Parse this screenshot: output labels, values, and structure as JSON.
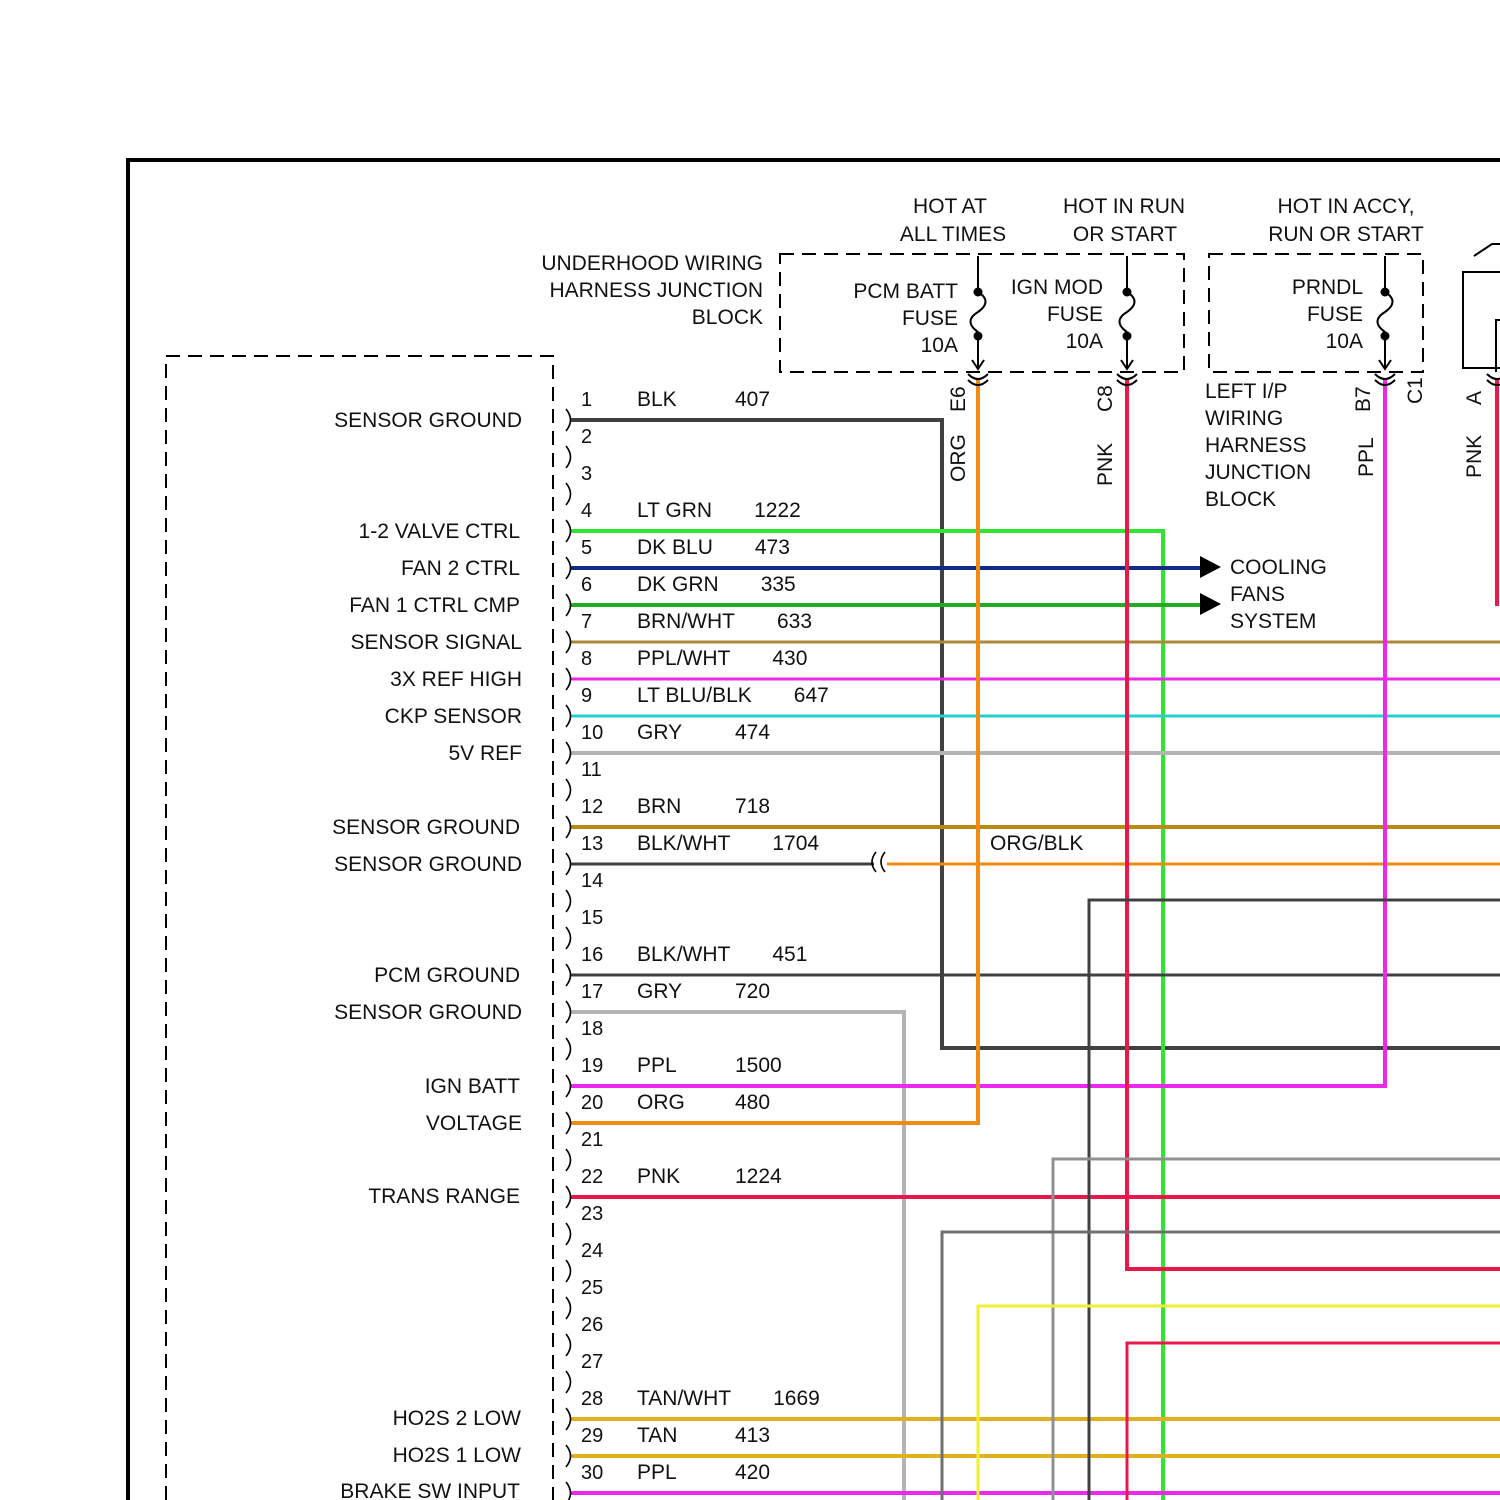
{
  "power_sources": [
    {
      "id": "hot-at-all-times",
      "lines": [
        "HOT AT",
        "ALL TIMES"
      ]
    },
    {
      "id": "hot-in-run-or-start",
      "lines": [
        "HOT IN RUN",
        "OR START"
      ]
    },
    {
      "id": "hot-in-accy-run-or-start",
      "lines": [
        "HOT IN ACCY,",
        "RUN OR START"
      ]
    }
  ],
  "junction_blocks": {
    "underhood": {
      "lines": [
        "UNDERHOOD WIRING",
        "HARNESS JUNCTION",
        "BLOCK"
      ]
    },
    "left_ip": {
      "lines": [
        "LEFT I/P",
        "WIRING",
        "HARNESS",
        "JUNCTION",
        "BLOCK"
      ]
    }
  },
  "fuses": [
    {
      "id": "pcm-batt",
      "lines": [
        "PCM BATT",
        "FUSE",
        "10A"
      ]
    },
    {
      "id": "ign-mod",
      "lines": [
        "IGN MOD",
        "FUSE",
        "10A"
      ]
    },
    {
      "id": "prndl",
      "lines": [
        "PRNDL",
        "FUSE",
        "10A"
      ]
    }
  ],
  "connector_terminals": [
    "E6",
    "C8",
    "B7",
    "C1",
    "A"
  ],
  "vertical_wire_labels": [
    "ORG",
    "PNK",
    "PPL",
    "PNK"
  ],
  "cooling_fans": {
    "lines": [
      "COOLING",
      "FANS",
      "SYSTEM"
    ]
  },
  "splice_label": "ORG/BLK",
  "pcm_functions": [
    {
      "pin": 1,
      "label": "SENSOR GROUND"
    },
    {
      "pin": 4,
      "label": "1-2 VALVE CTRL"
    },
    {
      "pin": 5,
      "label": "FAN 2 CTRL"
    },
    {
      "pin": 6,
      "label": "FAN 1 CTRL CMP"
    },
    {
      "pin": 7,
      "label": "SENSOR SIGNAL"
    },
    {
      "pin": 8,
      "label": "3X REF HIGH"
    },
    {
      "pin": 9,
      "label": "CKP SENSOR"
    },
    {
      "pin": 10,
      "label": "5V REF"
    },
    {
      "pin": 12,
      "label": "SENSOR GROUND"
    },
    {
      "pin": 13,
      "label": "SENSOR GROUND"
    },
    {
      "pin": 16,
      "label": "PCM GROUND"
    },
    {
      "pin": 17,
      "label": "SENSOR GROUND"
    },
    {
      "pin": 19,
      "label": "IGN BATT"
    },
    {
      "pin": 20,
      "label": "VOLTAGE"
    },
    {
      "pin": 22,
      "label": "TRANS RANGE"
    },
    {
      "pin": 28,
      "label": "HO2S 2 LOW"
    },
    {
      "pin": 29,
      "label": "HO2S 1 LOW"
    },
    {
      "pin": 30,
      "label": "BRAKE SW INPUT"
    }
  ],
  "pins": [
    {
      "n": "1",
      "color": "BLK",
      "circuit": "407"
    },
    {
      "n": "2",
      "color": "",
      "circuit": ""
    },
    {
      "n": "3",
      "color": "",
      "circuit": ""
    },
    {
      "n": "4",
      "color": "LT GRN",
      "circuit": "1222"
    },
    {
      "n": "5",
      "color": "DK BLU",
      "circuit": "473"
    },
    {
      "n": "6",
      "color": "DK GRN",
      "circuit": "335"
    },
    {
      "n": "7",
      "color": "BRN/WHT",
      "circuit": "633"
    },
    {
      "n": "8",
      "color": "PPL/WHT",
      "circuit": "430"
    },
    {
      "n": "9",
      "color": "LT BLU/BLK",
      "circuit": "647"
    },
    {
      "n": "10",
      "color": "GRY",
      "circuit": "474"
    },
    {
      "n": "11",
      "color": "",
      "circuit": ""
    },
    {
      "n": "12",
      "color": "BRN",
      "circuit": "718"
    },
    {
      "n": "13",
      "color": "BLK/WHT",
      "circuit": "1704"
    },
    {
      "n": "14",
      "color": "",
      "circuit": ""
    },
    {
      "n": "15",
      "color": "",
      "circuit": ""
    },
    {
      "n": "16",
      "color": "BLK/WHT",
      "circuit": "451"
    },
    {
      "n": "17",
      "color": "GRY",
      "circuit": "720"
    },
    {
      "n": "18",
      "color": "",
      "circuit": ""
    },
    {
      "n": "19",
      "color": "PPL",
      "circuit": "1500"
    },
    {
      "n": "20",
      "color": "ORG",
      "circuit": "480"
    },
    {
      "n": "21",
      "color": "",
      "circuit": ""
    },
    {
      "n": "22",
      "color": "PNK",
      "circuit": "1224"
    },
    {
      "n": "23",
      "color": "",
      "circuit": ""
    },
    {
      "n": "24",
      "color": "",
      "circuit": ""
    },
    {
      "n": "25",
      "color": "",
      "circuit": ""
    },
    {
      "n": "26",
      "color": "",
      "circuit": ""
    },
    {
      "n": "27",
      "color": "",
      "circuit": ""
    },
    {
      "n": "28",
      "color": "TAN/WHT",
      "circuit": "1669"
    },
    {
      "n": "29",
      "color": "TAN",
      "circuit": "413"
    },
    {
      "n": "30",
      "color": "PPL",
      "circuit": "420"
    }
  ],
  "wire_colors": {
    "black": "#404040",
    "orange": "#f08c14",
    "pink": "#e8184a",
    "magenta": "#ec28ec",
    "light_green": "#30e430",
    "dark_blue": "#102a8c",
    "dark_green": "#22aa22",
    "brown_white": "#a88a3a",
    "light_blue": "#22d0d0",
    "gray": "#b4b4b4",
    "brown": "#b88a10",
    "yellow": "#f0f030",
    "tan": "#e0b020"
  }
}
